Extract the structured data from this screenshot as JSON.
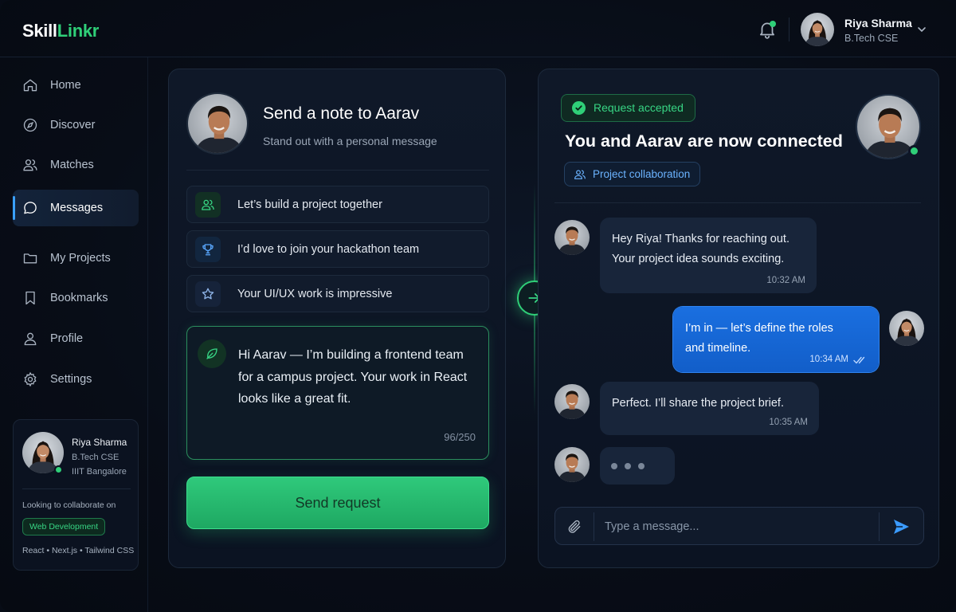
{
  "brand": {
    "part1": "Skill",
    "part2": "Linkr"
  },
  "user": {
    "name": "Riya Sharma",
    "program": "B.Tech CSE",
    "college": "IIIT Bangalore"
  },
  "nav": [
    {
      "label": "Home",
      "icon": "home-icon",
      "active": false
    },
    {
      "label": "Discover",
      "icon": "compass-icon",
      "active": false
    },
    {
      "label": "Matches",
      "icon": "users-icon",
      "active": false
    },
    {
      "label": "Messages",
      "icon": "chat-bubble-icon",
      "active": true
    },
    {
      "label": "My Projects",
      "icon": "folder-icon",
      "active": false
    },
    {
      "label": "Bookmarks",
      "icon": "bookmark-icon",
      "active": false
    },
    {
      "label": "Profile",
      "icon": "user-icon",
      "active": false
    },
    {
      "label": "Settings",
      "icon": "gear-icon",
      "active": false
    }
  ],
  "profile_card": {
    "looking_label": "Looking to collaborate on",
    "tag": "Web Development",
    "stack": "React • Next.js • Tailwind CSS"
  },
  "note_panel": {
    "title": "Send a note to Aarav",
    "subtitle": "Stand out with a personal message",
    "suggestions": [
      {
        "text": "Let’s build a project together",
        "icon": "users-icon"
      },
      {
        "text": "I’d love to join your hackathon team",
        "icon": "trophy-icon"
      },
      {
        "text": "Your UI/UX work is impressive",
        "icon": "star-icon"
      }
    ],
    "message": "Hi Aarav — I’m building a frontend team for a campus project. Your work in React looks like a great fit.",
    "char_count": "96/250",
    "send_label": "Send request"
  },
  "chat_panel": {
    "status_badge": "Request accepted",
    "title": "You and Aarav are now connected",
    "context_badge": "Project collaboration",
    "messages": [
      {
        "from": "Aarav",
        "lines": [
          "Hey Riya! Thanks for reaching out.",
          "Your project idea sounds exciting."
        ],
        "time": "10:32 AM"
      },
      {
        "from": "Riya",
        "lines": [
          "I’m in — let’s define the roles",
          "and timeline."
        ],
        "time": "10:34 AM"
      },
      {
        "from": "Aarav",
        "lines": [
          "Perfect. I’ll share the project brief."
        ],
        "time": "10:35 AM"
      }
    ],
    "composer_placeholder": "Type a message..."
  },
  "colors": {
    "accent_green": "#2fcf78",
    "accent_blue": "#1a6fe0",
    "background": "#070c16"
  }
}
